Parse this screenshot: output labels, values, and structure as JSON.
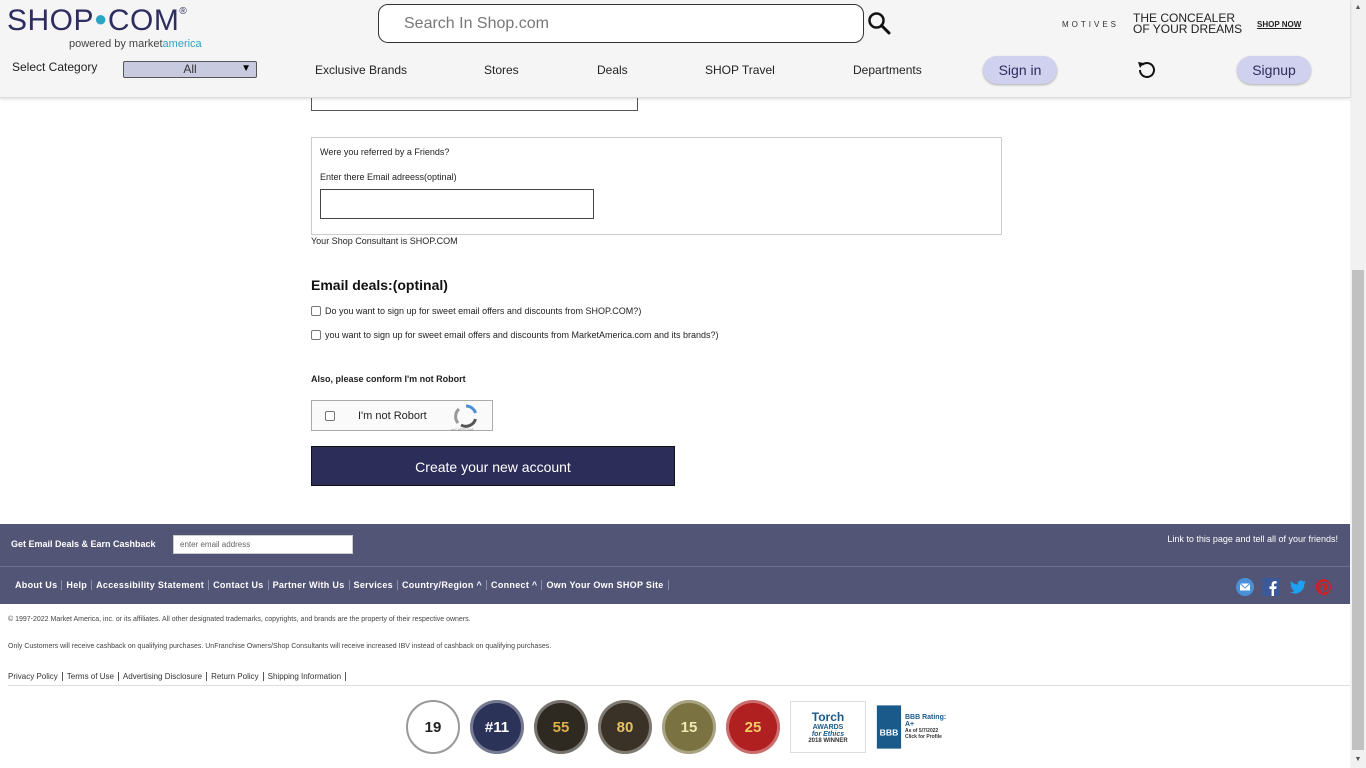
{
  "header": {
    "logo_text": "SHOP",
    "logo_text2": "COM",
    "powered_prefix": "powered by market",
    "powered_suffix": "america",
    "search_placeholder": "Search In Shop.com",
    "promo_brand": "MOTIVES",
    "promo_tagline_1": "THE CONCEALER",
    "promo_tagline_2": "OF YOUR DREAMS",
    "promo_link": "SHOP NOW",
    "category_label": "Select Category",
    "category_value": "All",
    "nav": [
      "Exclusive Brands",
      "Stores",
      "Deals",
      "SHOP Travel",
      "Departments"
    ],
    "signin_label": "Sign in",
    "signup_label": "Signup"
  },
  "form": {
    "referral_question": "Were you referred by a Friends?",
    "referral_email_label": "Enter there Email adreess(optinal)",
    "referral_email_value": "",
    "consultant_text": "Your Shop Consultant is SHOP.COM",
    "email_deals_title": "Email deals:(optinal)",
    "optin_shop": "Do you want to sign up for sweet email offers and discounts from SHOP.COM?)",
    "optin_ma": "you want to sign up for sweet email offers and discounts from MarketAmerica.com and its brands?)",
    "robot_question": "Also, please conform I'm not Robort",
    "captcha_label": "I'm not Robort",
    "captcha_brand": "reCAPTCHA",
    "create_button": "Create your new account"
  },
  "footer": {
    "deals_label": "Get Email Deals & Earn Cashback",
    "deals_placeholder": "enter email address",
    "share_text": "Link to this page and tell all of your friends!",
    "links": [
      "About Us",
      "Help",
      "Accessibility Statement",
      "Contact Us",
      "Partner With Us",
      "Services",
      "Country/Region ^",
      "Connect ^",
      "Own Your Own SHOP Site"
    ],
    "copyright": "© 1997-2022 Market America, inc. or its affiliates. All other designated trademarks, copyrights, and brands are the property of their respective owners.",
    "cashback_note": "Only Customers will receive cashback on qualifying purchases. UnFranchise Owners/Shop Consultants will receive increased IBV instead of cashback on qualifying purchases.",
    "legal_links": [
      "Privacy Policy",
      "Terms of Use",
      "Advertising Disclosure",
      "Return Policy",
      "Shipping Information"
    ],
    "badges": [
      "19",
      "#11",
      "55",
      "80",
      "15",
      "25"
    ],
    "torch_title": "Torch",
    "torch_sub": "AWARDS",
    "torch_sub2": "for Ethics",
    "torch_winner": "2018 WINNER",
    "bbb_rating": "BBB Rating: A+",
    "bbb_date": "As of 5/7/2022",
    "bbb_click": "Click for Profile"
  },
  "colors": {
    "brand_navy": "#2d2d5a",
    "accent_teal": "#2ea3c4",
    "footer_bg": "#525575",
    "pill_bg": "#cfd1ee"
  }
}
